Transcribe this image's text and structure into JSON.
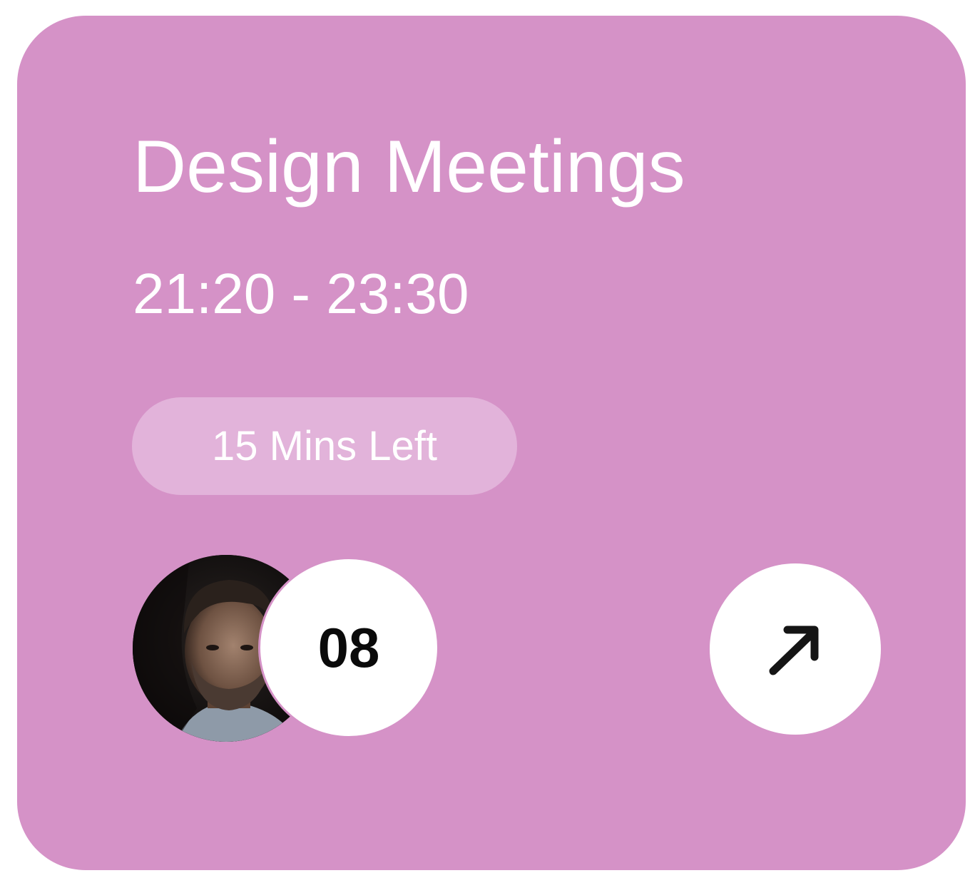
{
  "card": {
    "title": "Design Meetings",
    "time_range": "21:20 - 23:30",
    "badge": "15 Mins Left",
    "participants_count": "08",
    "accent_color": "#d592c7",
    "badge_color": "#e2b3da"
  },
  "icons": {
    "avatar": "user-avatar-photo",
    "open": "arrow-up-right-icon"
  }
}
